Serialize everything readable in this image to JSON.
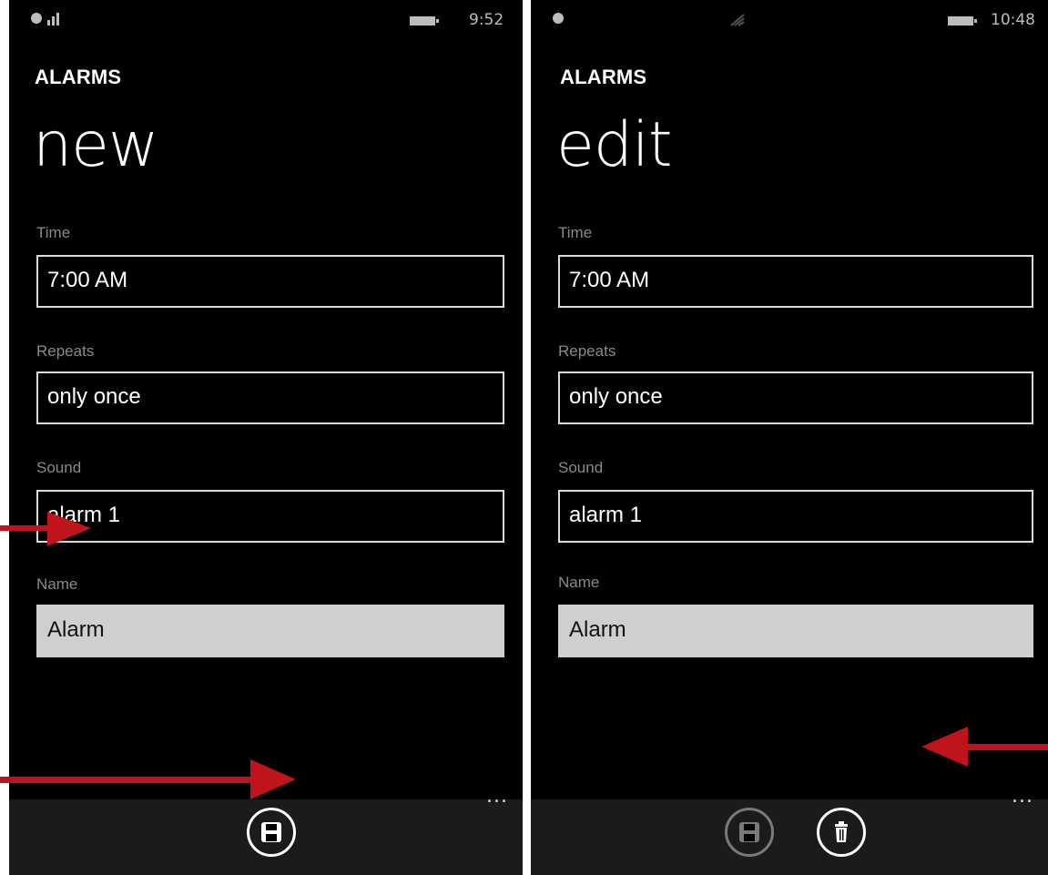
{
  "left_screen": {
    "status": {
      "time": "9:52"
    },
    "app_title": "ALARMS",
    "page_title": "new",
    "fields": {
      "time": {
        "label": "Time",
        "value": "7:00 AM"
      },
      "repeats": {
        "label": "Repeats",
        "value": "only once"
      },
      "sound": {
        "label": "Sound",
        "value": "alarm 1"
      },
      "name": {
        "label": "Name",
        "value": "Alarm"
      }
    },
    "appbar": {
      "more": "...",
      "buttons": [
        {
          "icon": "save-icon",
          "enabled": true
        }
      ]
    }
  },
  "right_screen": {
    "status": {
      "time": "10:48"
    },
    "app_title": "ALARMS",
    "page_title": "edit",
    "fields": {
      "time": {
        "label": "Time",
        "value": "7:00 AM"
      },
      "repeats": {
        "label": "Repeats",
        "value": "only once"
      },
      "sound": {
        "label": "Sound",
        "value": "alarm 1"
      },
      "name": {
        "label": "Name",
        "value": "Alarm"
      }
    },
    "appbar": {
      "more": "...",
      "buttons": [
        {
          "icon": "save-icon",
          "enabled": false
        },
        {
          "icon": "delete-icon",
          "enabled": true
        }
      ]
    }
  },
  "annotation": {
    "arrow_color": "#c0141c"
  }
}
